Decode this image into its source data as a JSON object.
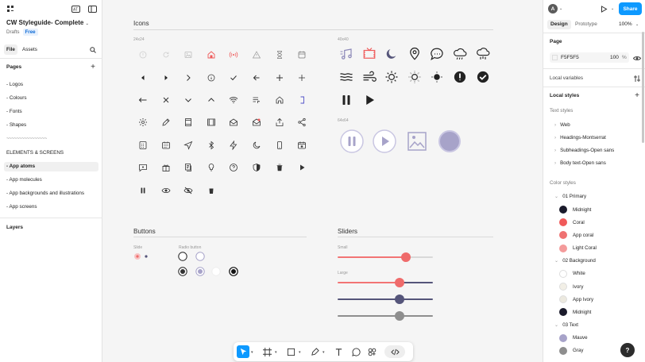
{
  "left_panel": {
    "file_name": "CW Styleguide- Complete",
    "drafts": "Drafts",
    "plan": "Free",
    "tabs": [
      "File",
      "Assets"
    ],
    "pages_heading": "Pages",
    "pages": [
      "- Logos",
      "- Colours",
      "- Fonts",
      "- Shapes",
      "~~~~~~~~~~~~~~~~",
      "ELEMENTS & SCREENS",
      "- App atoms",
      "- App molecules",
      "- App backgrounds and illustrations",
      "- App screens"
    ],
    "selected_page": "- App atoms",
    "layers_heading": "Layers"
  },
  "canvas": {
    "icons_title": "Icons",
    "size_24": "24x24",
    "size_40": "40x40",
    "size_64": "64x64",
    "buttons_title": "Buttons",
    "slide_label": "Slide",
    "radio_label": "Radio button",
    "sliders_title": "Sliders",
    "small_label": "Small",
    "large_label": "Large",
    "icons_24": [
      [
        "circle-info-faint-icon",
        "refresh-icon",
        "image-icon",
        "home-red-icon",
        "broadcast-red-icon",
        "warning-icon",
        "hourglass-icon",
        "calendar-icon"
      ],
      [
        "chevron-left-filled-icon",
        "chevron-right-filled-icon",
        "chevron-right-icon",
        "info-icon",
        "check-icon",
        "arrow-left-icon",
        "plus-icon",
        "plus-thin-icon"
      ],
      [
        "arrow-long-left-icon",
        "close-icon",
        "chevron-down-icon",
        "chevron-up-icon",
        "wifi-icon",
        "playlist-icon",
        "home-icon",
        "bracket-icon"
      ],
      [
        "gear-icon",
        "pencil-icon",
        "film-icon",
        "film-strip-icon",
        "mail-open-icon",
        "mail-notify-icon",
        "share-upload-icon",
        "share-nodes-icon"
      ],
      [
        "calculator-icon",
        "calendar-grid-icon",
        "navigation-icon",
        "bluetooth-icon",
        "lightning-icon",
        "moon-icon",
        "phone-icon",
        "calendar-star-icon"
      ],
      [
        "chat-star-icon",
        "gift-icon",
        "document-icon",
        "lightbulb-icon",
        "question-icon",
        "shield-icon",
        "trash-filled-icon",
        "play-filled-icon"
      ],
      [
        "pause-filled-icon",
        "eye-icon",
        "eye-off-icon",
        "trash-icon"
      ]
    ],
    "icons_40": [
      [
        "music-icon",
        "tv-icon",
        "moon-filled-icon",
        "location-pin-icon",
        "chat-bubble-icon",
        "cloud-rain-icon",
        "cloud-rain-alt-icon"
      ],
      [
        "waves-icon",
        "wind-icon",
        "sun-icon",
        "sun-filled-icon",
        "sun-dark-icon",
        "alert-circle-icon",
        "check-circle-icon"
      ],
      [
        "pause-icon",
        "play-icon"
      ]
    ],
    "icons_64": [
      "pause-circle-icon",
      "play-circle-icon",
      "image-frame-icon",
      "disc-icon"
    ],
    "sliders": [
      {
        "name": "small-coral",
        "value": 0.72,
        "color": "#f27474",
        "thumb": "#ef6b6b",
        "rest": "#d9d9d9"
      },
      {
        "name": "large-coral",
        "value": 0.65,
        "color": "#f27474",
        "thumb": "#ef6b6b",
        "rest": "#55557a"
      },
      {
        "name": "large-midnight",
        "value": 0.65,
        "color": "#55557a",
        "thumb": "#55557a",
        "rest": "#55557a"
      },
      {
        "name": "large-gray",
        "value": 0.65,
        "color": "#8e8e8e",
        "thumb": "#8e8e8e",
        "rest": "#8e8e8e"
      }
    ]
  },
  "toolbar": [
    "move-tool-icon",
    "frame-tool-icon",
    "shape-tool-icon",
    "pen-tool-icon",
    "text-tool-icon",
    "comment-tool-icon",
    "components-icon",
    "dev-mode-icon"
  ],
  "right_panel": {
    "avatar": "A",
    "share": "Share",
    "tabs": [
      "Design",
      "Prototype"
    ],
    "zoom": "100%",
    "page_heading": "Page",
    "fill_hex": "F5F5F5",
    "fill_opacity": "100",
    "fill_unit": "%",
    "local_variables": "Local variables",
    "local_styles": "Local styles",
    "text_styles": "Text styles",
    "text_style_items": [
      "Web",
      "Headings-Montserrat",
      "Subheadings-Open sans",
      "Body text-Open sans"
    ],
    "color_styles": "Color styles",
    "color_groups": [
      {
        "name": "01 Primary",
        "items": [
          {
            "label": "Midnight",
            "color": "#1a1a2b"
          },
          {
            "label": "Coral",
            "color": "#f05a5a"
          },
          {
            "label": "App coral",
            "color": "#ef7272"
          },
          {
            "label": "Light Coral",
            "color": "#f49b9b"
          }
        ]
      },
      {
        "name": "02 Background",
        "items": [
          {
            "label": "White",
            "color": "#ffffff"
          },
          {
            "label": "Ivory",
            "color": "#f2efe6"
          },
          {
            "label": "App Ivory",
            "color": "#ece9df"
          },
          {
            "label": "Midnight",
            "color": "#1a1a2b"
          }
        ]
      },
      {
        "name": "03 Text",
        "items": [
          {
            "label": "Mauve",
            "color": "#a7a3c9"
          },
          {
            "label": "Gray",
            "color": "#8e8e8e"
          }
        ]
      }
    ],
    "help": "?"
  }
}
